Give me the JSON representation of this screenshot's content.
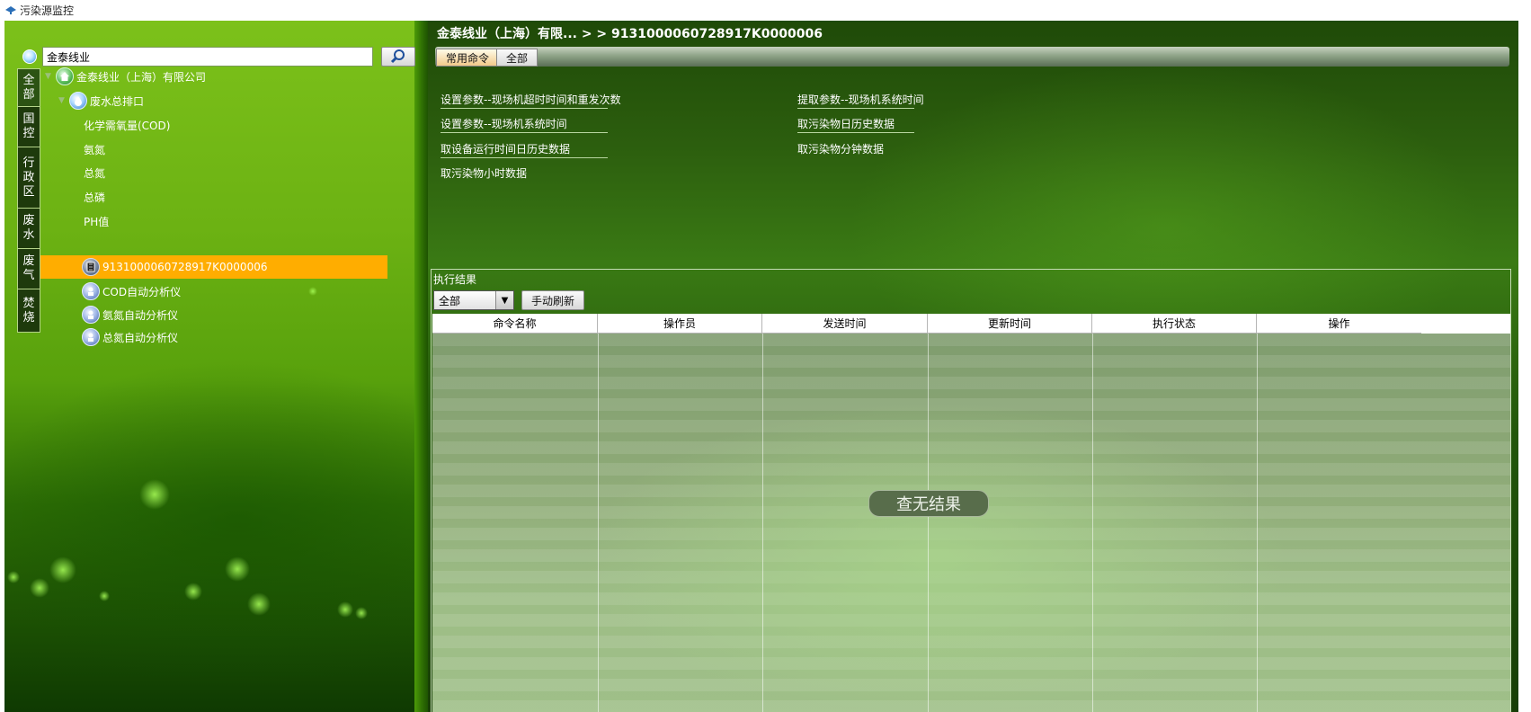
{
  "window": {
    "title": "污染源监控"
  },
  "search": {
    "value": "金泰线业"
  },
  "vertical_tabs": [
    {
      "label": "全\n部"
    },
    {
      "label": "国\n控"
    },
    {
      "label": "行\n政\n区"
    },
    {
      "label": "废\n水"
    },
    {
      "label": "废\n气"
    },
    {
      "label": "焚\n烧"
    }
  ],
  "tree": {
    "company": "金泰线业（上海）有限公司",
    "outlet": "废水总排口",
    "factors": [
      "化学需氧量(COD)",
      "氨氮",
      "总氮",
      "总磷",
      "PH值"
    ],
    "gateway": "9131000060728917K0000006",
    "analyzers": [
      "COD自动分析仪",
      "氨氮自动分析仪",
      "总氮自动分析仪"
    ]
  },
  "header": {
    "breadcrumb": "金泰线业（上海）有限... > > 9131000060728917K0000006"
  },
  "toolbar": {
    "common_label": "常用命令",
    "all_label": "全部"
  },
  "commands": {
    "left": [
      "设置参数--现场机超时时间和重发次数",
      "设置参数--现场机系统时间",
      "取设备运行时间日历史数据",
      "取污染物小时数据"
    ],
    "right": [
      "提取参数--现场机系统时间",
      "取污染物日历史数据",
      "取污染物分钟数据"
    ]
  },
  "results": {
    "title": "执行结果",
    "filter_value": "全部",
    "refresh_label": "手动刷新",
    "columns": [
      "命令名称",
      "操作员",
      "发送时间",
      "更新时间",
      "执行状态",
      "操作"
    ],
    "empty_text": "查无结果"
  },
  "colors": {
    "selection": "#ffad00",
    "panel_green": "#2c5e0e"
  }
}
